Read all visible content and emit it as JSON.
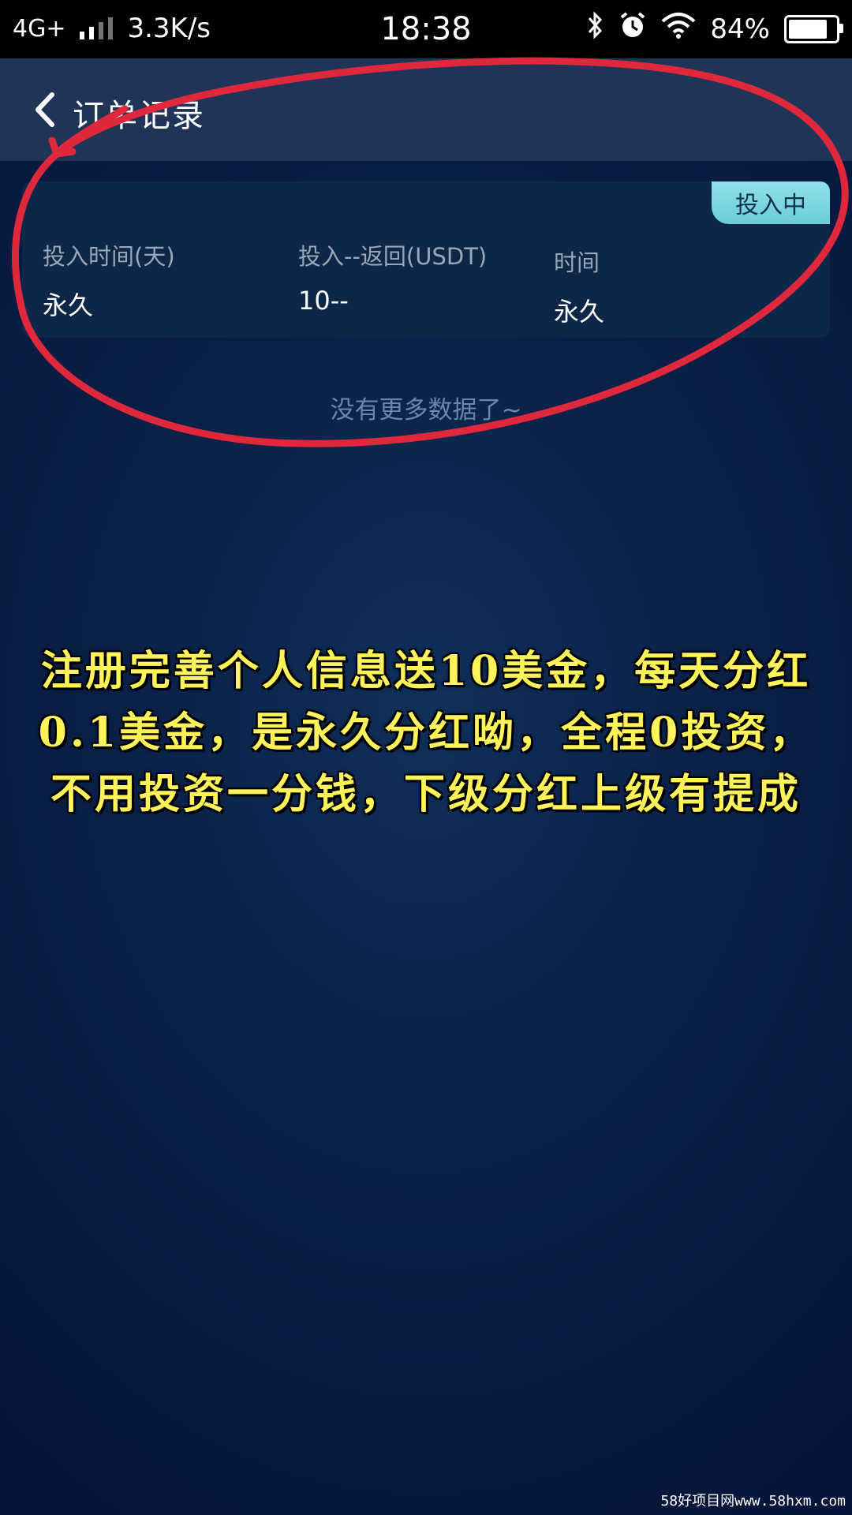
{
  "status_bar": {
    "network": "4G+",
    "speed": "3.3K/s",
    "time": "18:38",
    "battery": "84%",
    "battery_level": 0.84
  },
  "header": {
    "title": "订单记录"
  },
  "order": {
    "badge": "投入中",
    "col1_label": "投入时间(天)",
    "col1_value": "永久",
    "col2_label": "投入--返回(USDT)",
    "col2_value": "10--",
    "col3_label": "时间",
    "col3_value": "永久"
  },
  "list_end_text": "没有更多数据了~",
  "overlay_text": "注册完善个人信息送10美金，每天分红0.1美金，是永久分红呦，全程0投资，不用投资一分钱，下级分红上级有提成",
  "watermark": "58好项目网www.58hxm.com",
  "colors": {
    "background": "#0a2047",
    "header": "#1f3457",
    "card": "#0c2748",
    "badge": "#7dd6e1",
    "overlay_text": "#fff35a",
    "annotation": "#e0283c"
  }
}
